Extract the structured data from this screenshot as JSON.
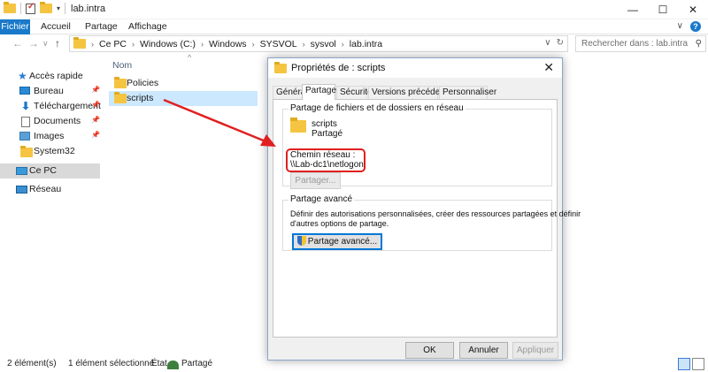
{
  "window": {
    "title": "lab.intra",
    "controls": {
      "minimize": "—",
      "maximize": "☐",
      "close": "✕"
    }
  },
  "ribbon": {
    "tabs": [
      "Fichier",
      "Accueil",
      "Partage",
      "Affichage"
    ],
    "expand": "∨",
    "help": "?"
  },
  "nav": {
    "back": "←",
    "forward": "→",
    "recent": "∨",
    "up": "↑",
    "breadcrumb": [
      "Ce PC",
      "Windows (C:)",
      "Windows",
      "SYSVOL",
      "sysvol",
      "lab.intra"
    ],
    "dropdown": "∨",
    "refresh": "↻",
    "search_placeholder": "Rechercher dans : lab.intra"
  },
  "sidebar": {
    "items": [
      {
        "label": "Accès rapide",
        "icon": "star-icon"
      },
      {
        "label": "Bureau",
        "icon": "desktop-icon",
        "pinned": true
      },
      {
        "label": "Téléchargement",
        "icon": "download-icon",
        "pinned": true
      },
      {
        "label": "Documents",
        "icon": "document-icon",
        "pinned": true
      },
      {
        "label": "Images",
        "icon": "pictures-icon",
        "pinned": true
      },
      {
        "label": "System32",
        "icon": "folder-icon"
      },
      {
        "label": "Ce PC",
        "icon": "computer-icon",
        "selected": true
      },
      {
        "label": "Réseau",
        "icon": "network-icon"
      }
    ]
  },
  "filelist": {
    "column": "Nom",
    "items": [
      {
        "name": "Policies",
        "selected": false
      },
      {
        "name": "scripts",
        "selected": true
      }
    ]
  },
  "status": {
    "count": "2 élément(s)",
    "selection": "1 élément sélectionné",
    "state_label": "État :",
    "state_value": "Partagé"
  },
  "dialog": {
    "title": "Propriétés de : scripts",
    "close": "✕",
    "tabs": [
      "Général",
      "Partage",
      "Sécurité",
      "Versions précédentes",
      "Personnaliser"
    ],
    "active_tab": "Partage",
    "network_group": {
      "label": "Partage de fichiers et de dossiers en réseau",
      "folder_name": "scripts",
      "folder_state": "Partagé",
      "path_label": "Chemin réseau :",
      "path_value": "\\\\Lab-dc1\\netlogon",
      "share_button": "Partager..."
    },
    "advanced_group": {
      "label": "Partage avancé",
      "description_line1": "Définir des autorisations personnalisées, créer des ressources partagées et définir",
      "description_line2": "d'autres options de partage.",
      "button": "Partage avancé..."
    },
    "buttons": {
      "ok": "OK",
      "cancel": "Annuler",
      "apply": "Appliquer"
    }
  },
  "colors": {
    "accent": "#1979ca",
    "annotation": "#e02020",
    "selection": "#cce8ff"
  }
}
